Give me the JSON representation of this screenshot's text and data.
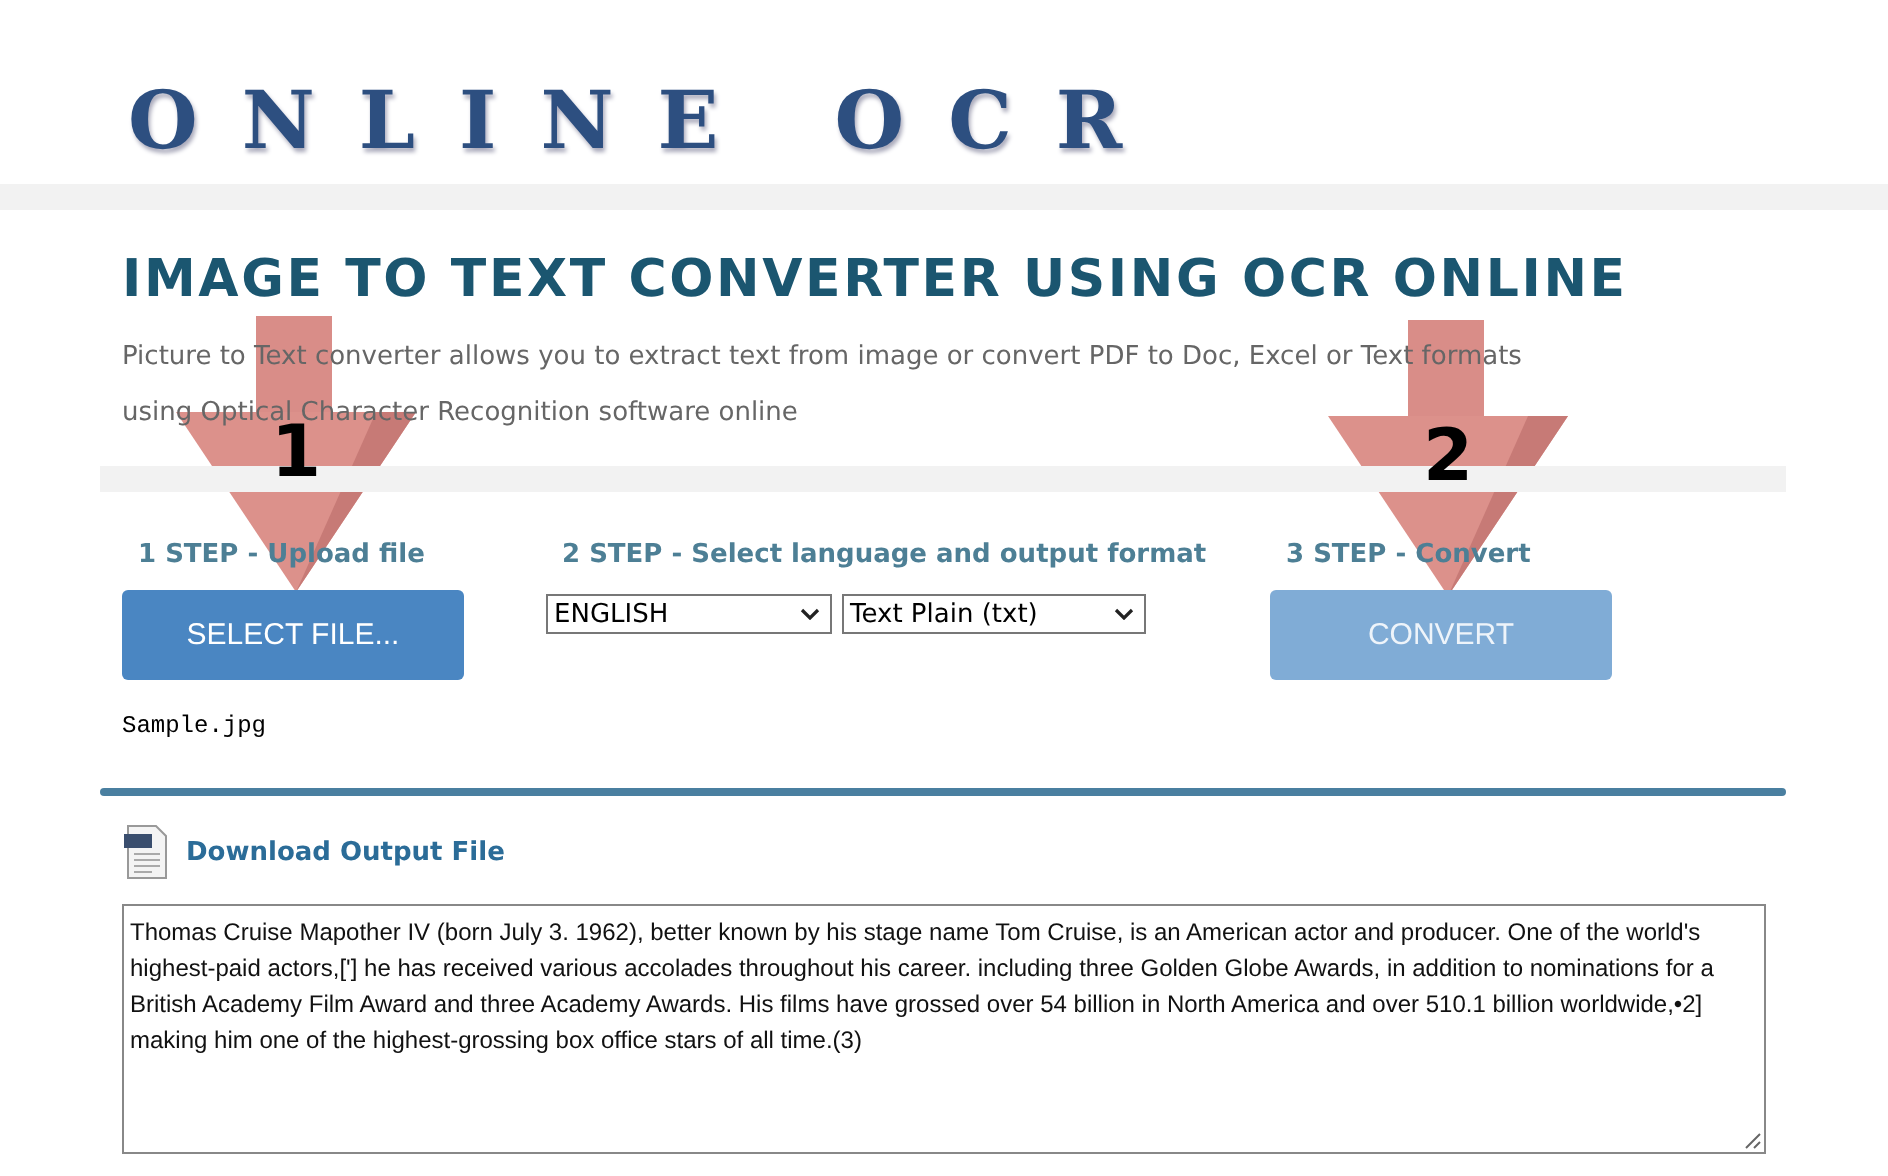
{
  "logo": {
    "text": "ONLINE OCR"
  },
  "title": "IMAGE TO TEXT CONVERTER USING OCR ONLINE",
  "description": "Picture to Text converter allows you to extract text from image or convert PDF to Doc, Excel or Text formats using Optical Character Recognition software online",
  "steps": [
    {
      "label": "1 STEP - Upload file",
      "kind": "button",
      "button": "SELECT FILE...",
      "file_name": "Sample.jpg",
      "disabled": false
    },
    {
      "label": "2 STEP - Select language and output format",
      "kind": "selects",
      "selects": [
        {
          "value": "ENGLISH"
        },
        {
          "value": "Text Plain (txt)"
        }
      ]
    },
    {
      "label": "3 STEP - Convert",
      "kind": "button",
      "button": "CONVERT",
      "disabled": true
    }
  ],
  "arrows": [
    {
      "number": "1"
    },
    {
      "number": "2"
    }
  ],
  "download_link": "Download Output File",
  "output_text": "Thomas Cruise Mapother IV (born July 3. 1962), better known by his stage name Tom Cruise, is an American actor and producer. One of the world's highest-paid actors,['] he has received various accolades throughout his career. including three Golden Globe Awards, in addition to nominations for a British Academy Film Award and three Academy Awards. His films have grossed over 54 billion in North America and over 510.1 billion worldwide,•2] making him one of the highest-grossing box office stars of all time.(3)"
}
